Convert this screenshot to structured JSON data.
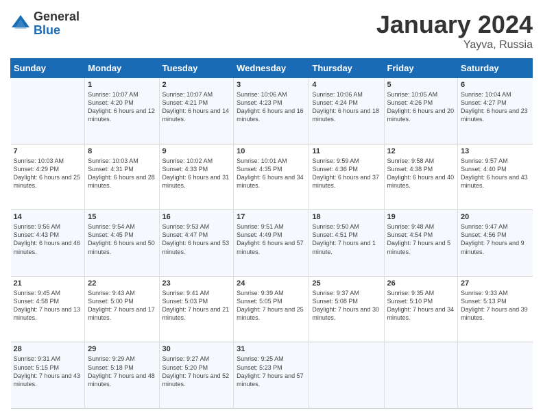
{
  "logo": {
    "general": "General",
    "blue": "Blue"
  },
  "header": {
    "month": "January 2024",
    "location": "Yayva, Russia"
  },
  "weekdays": [
    "Sunday",
    "Monday",
    "Tuesday",
    "Wednesday",
    "Thursday",
    "Friday",
    "Saturday"
  ],
  "weeks": [
    [
      {
        "day": "",
        "sunrise": "",
        "sunset": "",
        "daylight": ""
      },
      {
        "day": "1",
        "sunrise": "Sunrise: 10:07 AM",
        "sunset": "Sunset: 4:20 PM",
        "daylight": "Daylight: 6 hours and 12 minutes."
      },
      {
        "day": "2",
        "sunrise": "Sunrise: 10:07 AM",
        "sunset": "Sunset: 4:21 PM",
        "daylight": "Daylight: 6 hours and 14 minutes."
      },
      {
        "day": "3",
        "sunrise": "Sunrise: 10:06 AM",
        "sunset": "Sunset: 4:23 PM",
        "daylight": "Daylight: 6 hours and 16 minutes."
      },
      {
        "day": "4",
        "sunrise": "Sunrise: 10:06 AM",
        "sunset": "Sunset: 4:24 PM",
        "daylight": "Daylight: 6 hours and 18 minutes."
      },
      {
        "day": "5",
        "sunrise": "Sunrise: 10:05 AM",
        "sunset": "Sunset: 4:26 PM",
        "daylight": "Daylight: 6 hours and 20 minutes."
      },
      {
        "day": "6",
        "sunrise": "Sunrise: 10:04 AM",
        "sunset": "Sunset: 4:27 PM",
        "daylight": "Daylight: 6 hours and 23 minutes."
      }
    ],
    [
      {
        "day": "7",
        "sunrise": "Sunrise: 10:03 AM",
        "sunset": "Sunset: 4:29 PM",
        "daylight": "Daylight: 6 hours and 25 minutes."
      },
      {
        "day": "8",
        "sunrise": "Sunrise: 10:03 AM",
        "sunset": "Sunset: 4:31 PM",
        "daylight": "Daylight: 6 hours and 28 minutes."
      },
      {
        "day": "9",
        "sunrise": "Sunrise: 10:02 AM",
        "sunset": "Sunset: 4:33 PM",
        "daylight": "Daylight: 6 hours and 31 minutes."
      },
      {
        "day": "10",
        "sunrise": "Sunrise: 10:01 AM",
        "sunset": "Sunset: 4:35 PM",
        "daylight": "Daylight: 6 hours and 34 minutes."
      },
      {
        "day": "11",
        "sunrise": "Sunrise: 9:59 AM",
        "sunset": "Sunset: 4:36 PM",
        "daylight": "Daylight: 6 hours and 37 minutes."
      },
      {
        "day": "12",
        "sunrise": "Sunrise: 9:58 AM",
        "sunset": "Sunset: 4:38 PM",
        "daylight": "Daylight: 6 hours and 40 minutes."
      },
      {
        "day": "13",
        "sunrise": "Sunrise: 9:57 AM",
        "sunset": "Sunset: 4:40 PM",
        "daylight": "Daylight: 6 hours and 43 minutes."
      }
    ],
    [
      {
        "day": "14",
        "sunrise": "Sunrise: 9:56 AM",
        "sunset": "Sunset: 4:43 PM",
        "daylight": "Daylight: 6 hours and 46 minutes."
      },
      {
        "day": "15",
        "sunrise": "Sunrise: 9:54 AM",
        "sunset": "Sunset: 4:45 PM",
        "daylight": "Daylight: 6 hours and 50 minutes."
      },
      {
        "day": "16",
        "sunrise": "Sunrise: 9:53 AM",
        "sunset": "Sunset: 4:47 PM",
        "daylight": "Daylight: 6 hours and 53 minutes."
      },
      {
        "day": "17",
        "sunrise": "Sunrise: 9:51 AM",
        "sunset": "Sunset: 4:49 PM",
        "daylight": "Daylight: 6 hours and 57 minutes."
      },
      {
        "day": "18",
        "sunrise": "Sunrise: 9:50 AM",
        "sunset": "Sunset: 4:51 PM",
        "daylight": "Daylight: 7 hours and 1 minute."
      },
      {
        "day": "19",
        "sunrise": "Sunrise: 9:48 AM",
        "sunset": "Sunset: 4:54 PM",
        "daylight": "Daylight: 7 hours and 5 minutes."
      },
      {
        "day": "20",
        "sunrise": "Sunrise: 9:47 AM",
        "sunset": "Sunset: 4:56 PM",
        "daylight": "Daylight: 7 hours and 9 minutes."
      }
    ],
    [
      {
        "day": "21",
        "sunrise": "Sunrise: 9:45 AM",
        "sunset": "Sunset: 4:58 PM",
        "daylight": "Daylight: 7 hours and 13 minutes."
      },
      {
        "day": "22",
        "sunrise": "Sunrise: 9:43 AM",
        "sunset": "Sunset: 5:00 PM",
        "daylight": "Daylight: 7 hours and 17 minutes."
      },
      {
        "day": "23",
        "sunrise": "Sunrise: 9:41 AM",
        "sunset": "Sunset: 5:03 PM",
        "daylight": "Daylight: 7 hours and 21 minutes."
      },
      {
        "day": "24",
        "sunrise": "Sunrise: 9:39 AM",
        "sunset": "Sunset: 5:05 PM",
        "daylight": "Daylight: 7 hours and 25 minutes."
      },
      {
        "day": "25",
        "sunrise": "Sunrise: 9:37 AM",
        "sunset": "Sunset: 5:08 PM",
        "daylight": "Daylight: 7 hours and 30 minutes."
      },
      {
        "day": "26",
        "sunrise": "Sunrise: 9:35 AM",
        "sunset": "Sunset: 5:10 PM",
        "daylight": "Daylight: 7 hours and 34 minutes."
      },
      {
        "day": "27",
        "sunrise": "Sunrise: 9:33 AM",
        "sunset": "Sunset: 5:13 PM",
        "daylight": "Daylight: 7 hours and 39 minutes."
      }
    ],
    [
      {
        "day": "28",
        "sunrise": "Sunrise: 9:31 AM",
        "sunset": "Sunset: 5:15 PM",
        "daylight": "Daylight: 7 hours and 43 minutes."
      },
      {
        "day": "29",
        "sunrise": "Sunrise: 9:29 AM",
        "sunset": "Sunset: 5:18 PM",
        "daylight": "Daylight: 7 hours and 48 minutes."
      },
      {
        "day": "30",
        "sunrise": "Sunrise: 9:27 AM",
        "sunset": "Sunset: 5:20 PM",
        "daylight": "Daylight: 7 hours and 52 minutes."
      },
      {
        "day": "31",
        "sunrise": "Sunrise: 9:25 AM",
        "sunset": "Sunset: 5:23 PM",
        "daylight": "Daylight: 7 hours and 57 minutes."
      },
      {
        "day": "",
        "sunrise": "",
        "sunset": "",
        "daylight": ""
      },
      {
        "day": "",
        "sunrise": "",
        "sunset": "",
        "daylight": ""
      },
      {
        "day": "",
        "sunrise": "",
        "sunset": "",
        "daylight": ""
      }
    ]
  ]
}
